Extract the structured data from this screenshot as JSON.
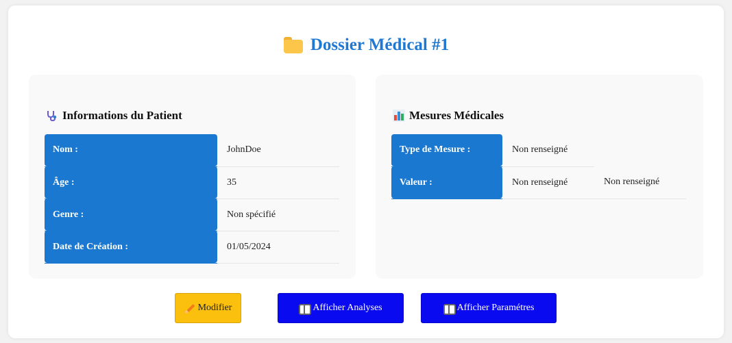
{
  "page": {
    "title": "Dossier Médical #1",
    "folder_icon": "folder-icon"
  },
  "patient": {
    "title": "Informations du Patient",
    "icon": "stethoscope-icon",
    "rows": [
      {
        "label": "Nom :",
        "value": "JohnDoe"
      },
      {
        "label": "Âge :",
        "value": "35"
      },
      {
        "label": "Genre :",
        "value": "Non spécifié"
      },
      {
        "label": "Date de Création :",
        "value": "01/05/2024"
      }
    ]
  },
  "measures": {
    "title": "Mesures Médicales",
    "icon": "bar-chart-icon",
    "type_label": "Type de Mesure :",
    "type_value": "Non renseigné",
    "value_label": "Valeur :",
    "value_values": [
      "Non renseigné",
      "Non renseigné"
    ]
  },
  "actions": {
    "edit_label": "Modifier",
    "edit_icon": "pencil-icon",
    "analyses_label": "Afficher Analyses",
    "analyses_icon": "book-icon",
    "params_label": "Afficher Paramétres",
    "params_icon": "book-icon"
  },
  "colors": {
    "accent": "#1f78d1",
    "header_cell": "#1a78d0",
    "edit_button": "#fbbf0d",
    "action_button": "#0a0af0"
  }
}
